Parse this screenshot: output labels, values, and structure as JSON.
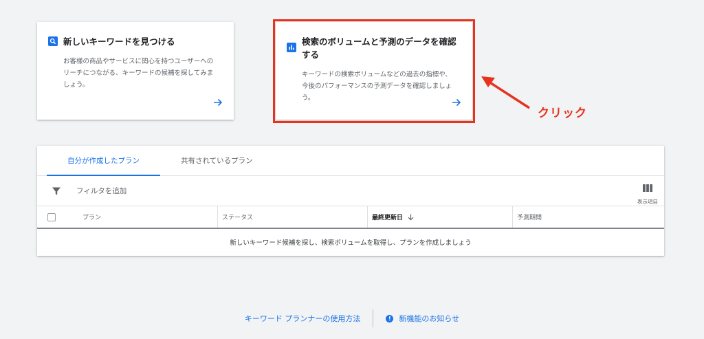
{
  "cards": [
    {
      "title": "新しいキーワードを見つける",
      "desc_line1": "お客様の商品やサービスに関心を持つユーザーへの",
      "desc_line2": "リーチにつながる、キーワードの候補を探してみま",
      "desc_line3": "しょう。",
      "icon": "search-icon"
    },
    {
      "title": "検索のボリュームと予測のデータを確認する",
      "desc_line1": "キーワードの検索ボリュームなどの過去の指標や、",
      "desc_line2": "今後のパフォーマンスの予測データを確認しましょ",
      "desc_line3": "う。",
      "icon": "bar-chart-icon"
    }
  ],
  "annotation": {
    "label": "クリック",
    "color": "#e8321e"
  },
  "tabs": [
    "自分が作成したプラン",
    "共有されているプラン"
  ],
  "filter": {
    "label": "フィルタを追加"
  },
  "columns_button": {
    "label": "表示項目"
  },
  "table": {
    "headers": [
      "プラン",
      "ステータス",
      "最終更新日",
      "予測期間"
    ],
    "empty_message": "新しいキーワード候補を探し、検索ボリュームを取得し、プランを作成しましょう"
  },
  "footer": {
    "link1": "キーワード プランナーの使用方法",
    "info_glyph": "!",
    "link2": "新機能のお知らせ"
  },
  "colors": {
    "accent": "#1a73e8",
    "background": "#f1f3f4"
  }
}
